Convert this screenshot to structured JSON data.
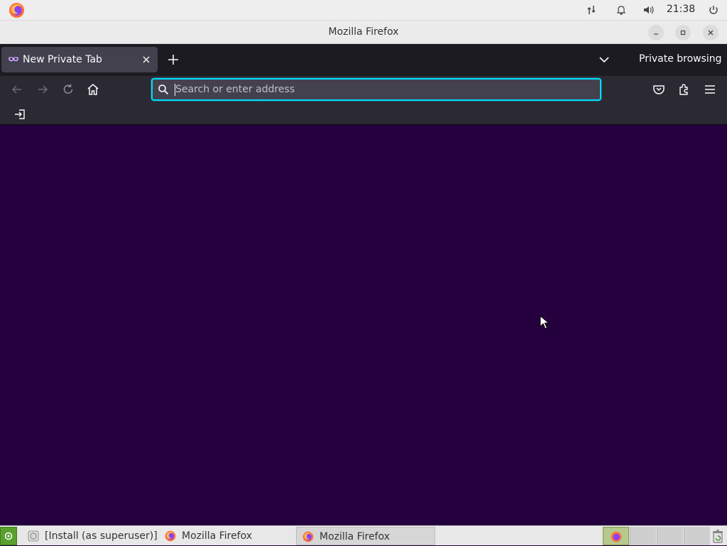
{
  "system_panel": {
    "clock": "21:38",
    "icons": [
      "firefox-icon",
      "network-icon",
      "bell-icon",
      "volume-icon",
      "power-icon"
    ]
  },
  "window": {
    "title": "Mozilla Firefox"
  },
  "tabs": [
    {
      "label": "New Private Tab",
      "icon": "private-mask-icon"
    }
  ],
  "toolbar": {
    "private_label": "Private browsing",
    "url_placeholder": "Search or enter address",
    "url_value": ""
  },
  "taskbar": {
    "tasks": [
      {
        "label": "[Install (as superuser)]",
        "icon": "installer-icon"
      },
      {
        "label": "Mozilla Firefox",
        "icon": "firefox-icon"
      },
      {
        "label": "Mozilla Firefox",
        "icon": "firefox-icon"
      }
    ]
  },
  "colors": {
    "accent_focus": "#00ddff",
    "private_bg": "#25003e",
    "toolbar_bg": "#2b2a33",
    "tabstrip_bg": "#1c1b22"
  }
}
